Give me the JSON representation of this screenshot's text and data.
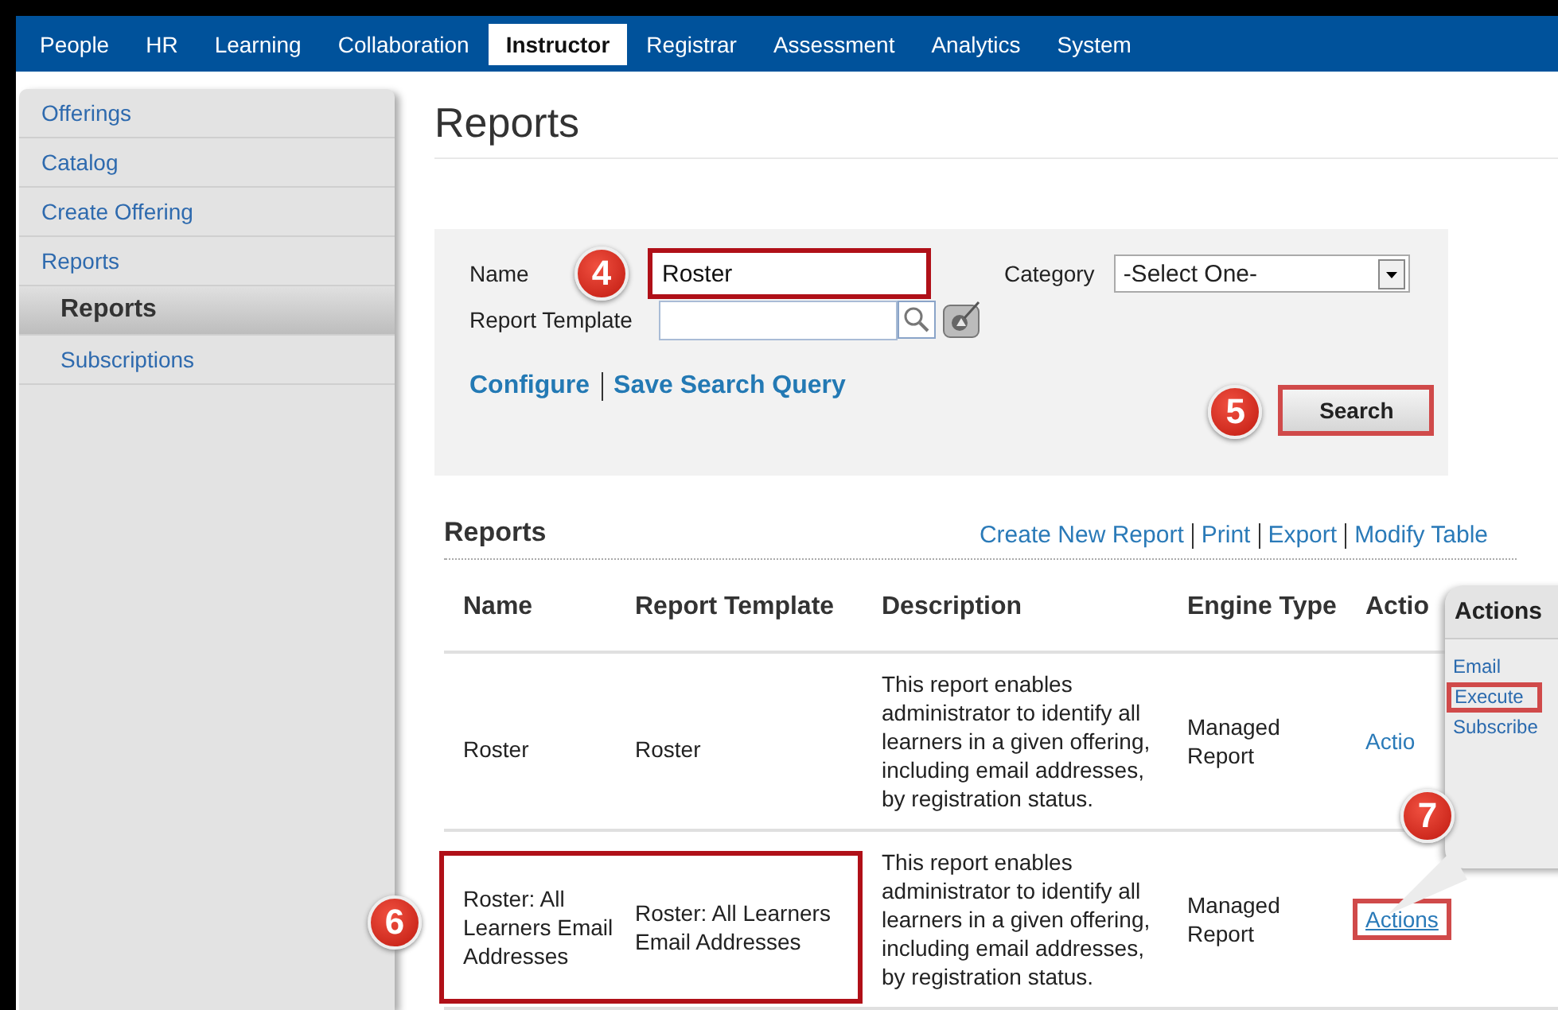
{
  "nav": {
    "tabs": [
      {
        "label": "People",
        "selected": false
      },
      {
        "label": "HR",
        "selected": false
      },
      {
        "label": "Learning",
        "selected": false
      },
      {
        "label": "Collaboration",
        "selected": false
      },
      {
        "label": "Instructor",
        "selected": true
      },
      {
        "label": "Registrar",
        "selected": false
      },
      {
        "label": "Assessment",
        "selected": false
      },
      {
        "label": "Analytics",
        "selected": false
      },
      {
        "label": "System",
        "selected": false
      }
    ]
  },
  "sidebar": {
    "items": [
      {
        "label": "Offerings",
        "selected": false
      },
      {
        "label": "Catalog",
        "selected": false
      },
      {
        "label": "Create Offering",
        "selected": false
      },
      {
        "label": "Reports",
        "selected": false,
        "children": [
          {
            "label": "Reports",
            "selected": true
          },
          {
            "label": "Subscriptions",
            "selected": false
          }
        ]
      }
    ]
  },
  "page_title": "Reports",
  "search_form": {
    "name_label": "Name",
    "name_callout": "4",
    "name_value": "Roster",
    "name_highlighted": true,
    "category_label": "Category",
    "category_value": "-Select One-",
    "template_label": "Report Template",
    "links": [
      "Configure",
      "Save Search Query"
    ],
    "search_callout": "5",
    "search_button": "Search",
    "search_highlighted": true
  },
  "reports": {
    "title": "Reports",
    "links": [
      "Create New Report",
      "Print",
      "Export",
      "Modify Table"
    ],
    "columns": [
      "Name",
      "Report Template",
      "Description",
      "Engine Type",
      "Actio"
    ],
    "rows": [
      {
        "name": "Roster",
        "template": "Roster",
        "description": "This report enables administrator to identify all learners in a given offering, including email addresses, by registration status.",
        "engine_type": "Managed Report",
        "action": "Actio",
        "highlighted": false,
        "action_highlighted": false
      },
      {
        "name": "Roster: All Learners Email Addresses",
        "template": "Roster: All Learners Email Addresses",
        "description": "This report enables administrator to identify all learners in a given offering, including email addresses, by registration status.",
        "engine_type": "Managed Report",
        "action": "Actions",
        "highlighted": true,
        "action_highlighted": true,
        "callout": "6"
      }
    ]
  },
  "actions_popover": {
    "title": "Actions",
    "callout": "7",
    "items": [
      {
        "label": "Email",
        "highlighted": false
      },
      {
        "label": "Execute",
        "highlighted": true
      },
      {
        "label": "Subscribe",
        "highlighted": false
      }
    ]
  }
}
